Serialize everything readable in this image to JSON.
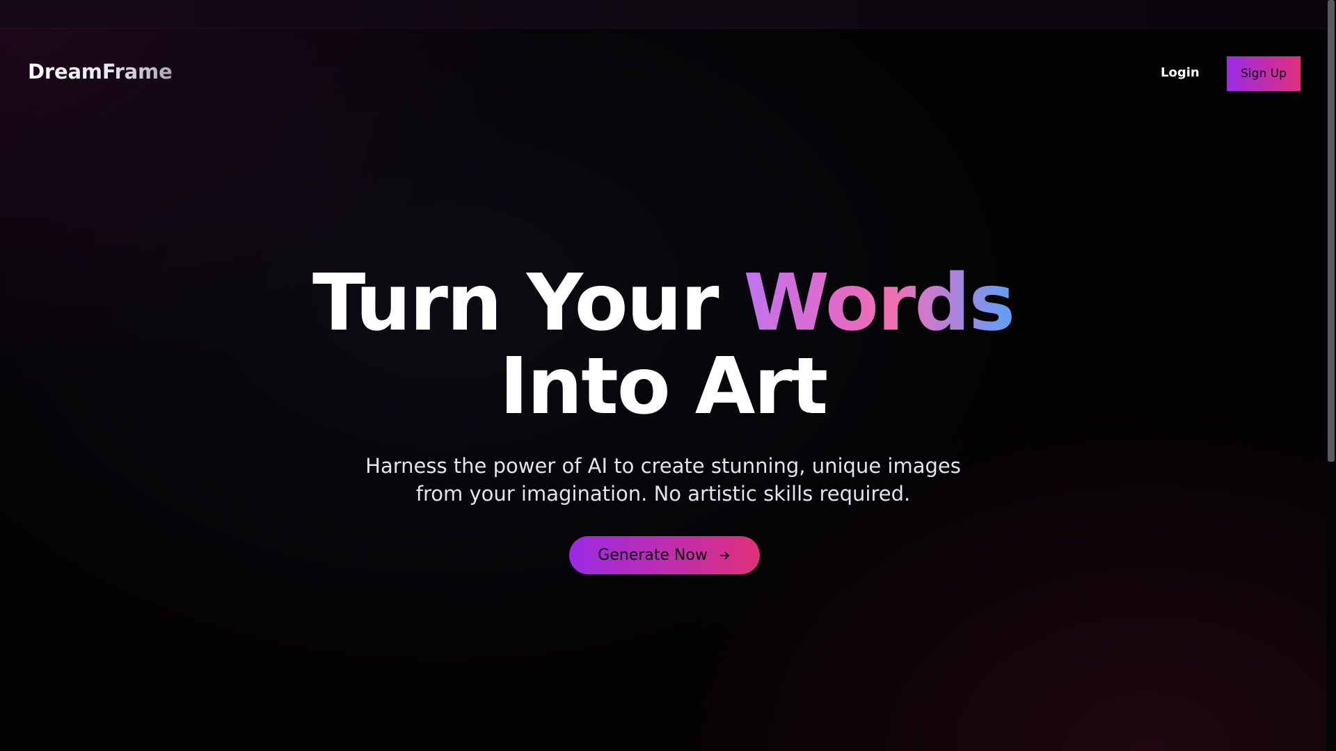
{
  "top_strip": {},
  "navbar": {
    "logo": "DreamFrame",
    "login_label": "Login",
    "signup_label": "Sign Up"
  },
  "hero": {
    "title_part1": "Turn Your ",
    "title_accent": "Words",
    "title_line2": "Into Art",
    "subtitle": "Harness the power of AI to create stunning, unique images from your imagination. No artistic skills required.",
    "cta_label": "Generate Now",
    "cta_icon": "arrow-right-icon"
  },
  "colors": {
    "background": "#000000",
    "accent_gradient_start": "#9a2be4",
    "accent_gradient_end": "#e0307c",
    "accent_word_gradient": [
      "#c074f0",
      "#f070b0",
      "#5aa2f4"
    ],
    "text_primary": "#ffffff",
    "text_secondary": "#e4e4ea"
  }
}
